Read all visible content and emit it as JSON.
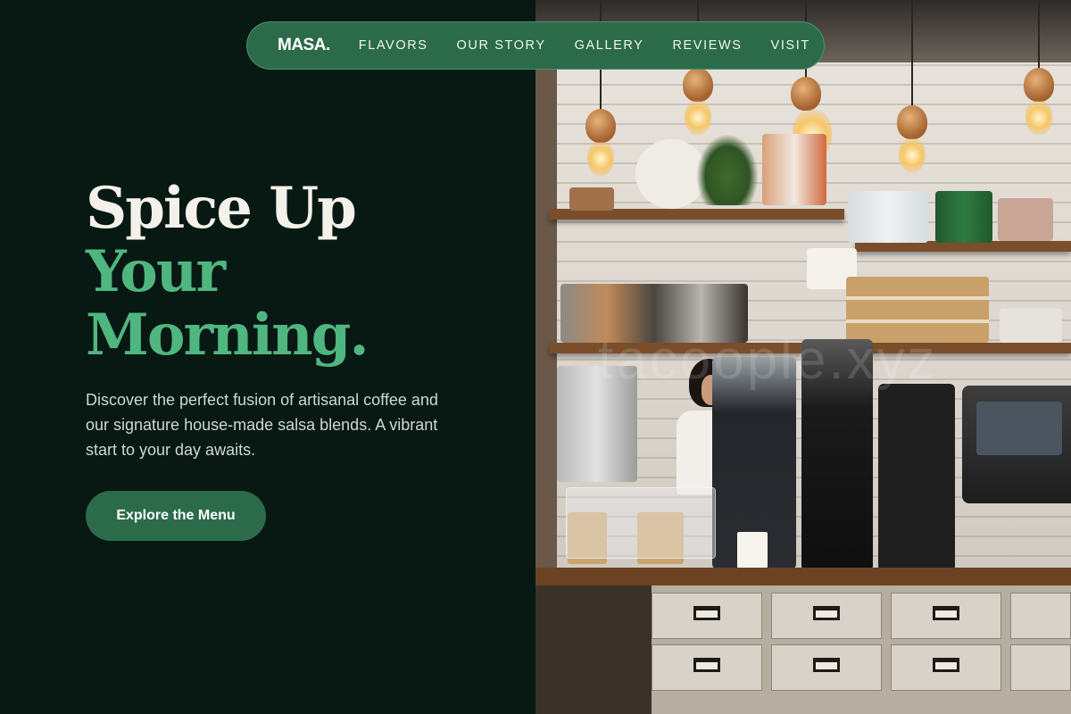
{
  "nav": {
    "logo": "MASA.",
    "links": [
      "FLAVORS",
      "OUR STORY",
      "GALLERY",
      "REVIEWS",
      "VISIT"
    ]
  },
  "hero": {
    "headline_line1": "Spice Up",
    "headline_line2": "Your",
    "headline_line3": "Morning.",
    "description": "Discover the perfect fusion of artisanal coffee and our signature house-made salsa blends. A vibrant start to your day awaits.",
    "cta_label": "Explore the Menu"
  },
  "photo": {
    "watermark": "tacoople.xyz"
  },
  "colors": {
    "background": "#081813",
    "accent_green": "#4fb680",
    "nav_pill": "#2c6b4a",
    "headline_light": "#f3f1ea"
  }
}
